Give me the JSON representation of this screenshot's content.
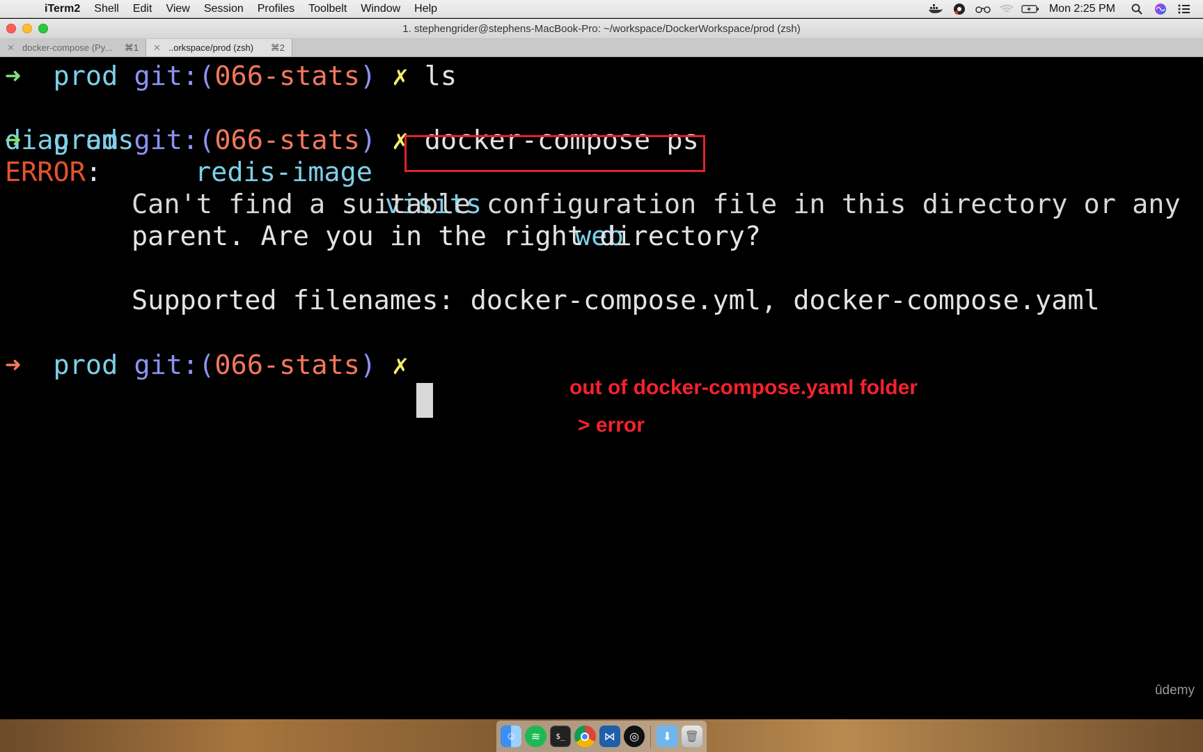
{
  "menubar": {
    "app_name": "iTerm2",
    "items": [
      "Shell",
      "Edit",
      "View",
      "Session",
      "Profiles",
      "Toolbelt",
      "Window",
      "Help"
    ],
    "clock": "Mon 2:25 PM"
  },
  "window": {
    "title": "1. stephengrider@stephens-MacBook-Pro: ~/workspace/DockerWorkspace/prod (zsh)"
  },
  "tabs": [
    {
      "label": "docker-compose (Py...",
      "shortcut": "⌘1"
    },
    {
      "label": "..orkspace/prod (zsh)",
      "shortcut": "⌘2"
    }
  ],
  "terminal": {
    "prompt_arrow": "➜",
    "prompt_dir": "prod",
    "prompt_git": "git:(",
    "prompt_branch": "066-stats",
    "prompt_git_close": ")",
    "prompt_dirty": "✗",
    "commands": [
      "ls",
      "docker-compose ps"
    ],
    "ls_output": [
      "diagrams",
      "redis-image",
      "visits",
      "web"
    ],
    "error_label": "ERROR",
    "error_colon": ":",
    "error_line1": "Can't find a suitable configuration file in this directory or any",
    "error_line2": "parent. Are you in the right directory?",
    "supported_line": "Supported filenames: docker-compose.yml, docker-compose.yaml"
  },
  "annotations": {
    "line1": "out of docker-compose.yaml folder",
    "line2": "> error"
  },
  "watermark": "ûdemy",
  "dock": {
    "icons": [
      "finder-icon",
      "spotify-icon",
      "terminal-icon",
      "chrome-icon",
      "vscode-icon",
      "obs-icon",
      "downloads-folder-icon",
      "trash-icon"
    ]
  }
}
